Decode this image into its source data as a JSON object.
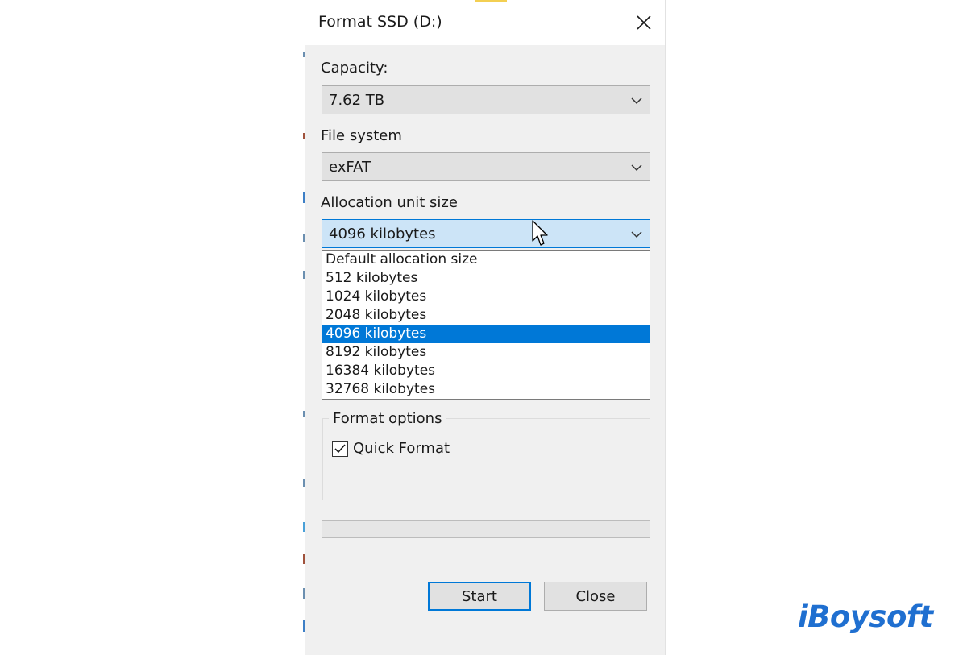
{
  "window": {
    "title": "Format SSD (D:)"
  },
  "capacity": {
    "label": "Capacity:",
    "value": "7.62 TB"
  },
  "file_system": {
    "label": "File system",
    "value": "exFAT"
  },
  "allocation": {
    "label": "Allocation unit size",
    "value": "4096 kilobytes",
    "options": [
      "Default allocation size",
      "512 kilobytes",
      "1024 kilobytes",
      "2048 kilobytes",
      "4096 kilobytes",
      "8192 kilobytes",
      "16384 kilobytes",
      "32768 kilobytes"
    ],
    "selected_index": 4
  },
  "format_options": {
    "legend": "Format options",
    "quick_format_label": "Quick Format",
    "quick_format_checked": true
  },
  "progress": {
    "fraction": 0
  },
  "buttons": {
    "start_label": "Start",
    "close_label": "Close"
  },
  "brand": {
    "name": "iBoysoft",
    "color": "#1f6fd0"
  },
  "colors": {
    "accent": "#0078d7",
    "dialog_bg": "#f0f0f0",
    "selected_bg": "#0078d7"
  }
}
